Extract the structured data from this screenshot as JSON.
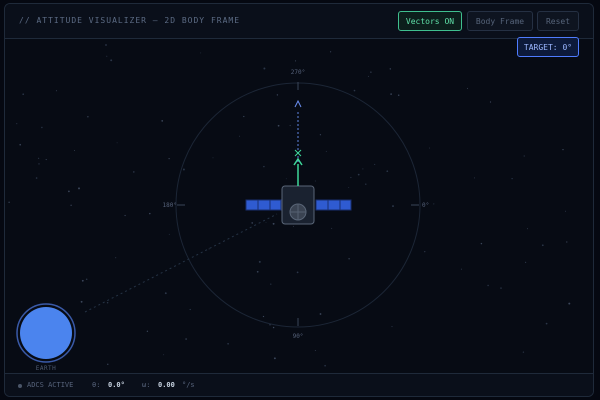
{
  "header": {
    "title": "// ATTITUDE VISUALIZER — 2D BODY FRAME",
    "buttons": {
      "vectors": "Vectors ON",
      "body_frame": "Body Frame",
      "reset": "Reset"
    }
  },
  "target": {
    "label": "TARGET: 0°"
  },
  "dial": {
    "deg_270": "270°",
    "deg_180": "180°",
    "deg_0": "0°",
    "deg_90": "90°"
  },
  "earth": {
    "label": "EARTH"
  },
  "status": {
    "state": "ADCS ACTIVE",
    "theta_label": "θ:",
    "theta_value": "0.0°",
    "omega_label": "ω:",
    "omega_value": "0.00",
    "omega_unit": "°/s"
  },
  "colors": {
    "background": "#050811",
    "accent_green": "#5fe0a8",
    "accent_blue": "#4f7cff",
    "solar_panel": "#2f5bd1"
  },
  "icons": {
    "status": "status-dot-icon",
    "spacecraft": "satellite-icon",
    "earth": "earth-icon"
  }
}
